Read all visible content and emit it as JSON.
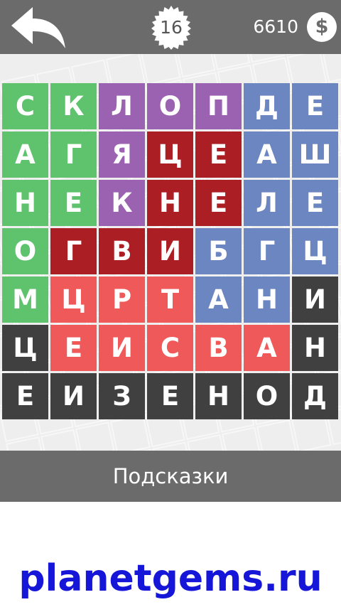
{
  "header": {
    "level": "16",
    "coins": "6610",
    "coin_symbol": "$"
  },
  "colors": {
    "green": "#5ec36c",
    "purple": "#9a62b0",
    "dark_red": "#ab1e24",
    "blue": "#6b86c0",
    "salmon": "#f0595a",
    "dark_gray": "#404040",
    "bar_gray": "#6b6b6b"
  },
  "board": {
    "rows": [
      [
        {
          "l": "С",
          "c": "green"
        },
        {
          "l": "К",
          "c": "green"
        },
        {
          "l": "Л",
          "c": "purple"
        },
        {
          "l": "О",
          "c": "purple"
        },
        {
          "l": "П",
          "c": "purple"
        },
        {
          "l": "Д",
          "c": "blue"
        },
        {
          "l": "Е",
          "c": "blue"
        }
      ],
      [
        {
          "l": "А",
          "c": "green"
        },
        {
          "l": "Г",
          "c": "green"
        },
        {
          "l": "Я",
          "c": "purple"
        },
        {
          "l": "Ц",
          "c": "dark_red"
        },
        {
          "l": "Е",
          "c": "dark_red"
        },
        {
          "l": "А",
          "c": "blue"
        },
        {
          "l": "Ш",
          "c": "blue"
        }
      ],
      [
        {
          "l": "Н",
          "c": "green"
        },
        {
          "l": "Е",
          "c": "green"
        },
        {
          "l": "К",
          "c": "purple"
        },
        {
          "l": "Н",
          "c": "dark_red"
        },
        {
          "l": "Е",
          "c": "dark_red"
        },
        {
          "l": "Л",
          "c": "blue"
        },
        {
          "l": "Е",
          "c": "blue"
        }
      ],
      [
        {
          "l": "О",
          "c": "green"
        },
        {
          "l": "Г",
          "c": "dark_red"
        },
        {
          "l": "В",
          "c": "dark_red"
        },
        {
          "l": "И",
          "c": "dark_red"
        },
        {
          "l": "Б",
          "c": "blue"
        },
        {
          "l": "Г",
          "c": "blue"
        },
        {
          "l": "Ц",
          "c": "blue"
        }
      ],
      [
        {
          "l": "М",
          "c": "green"
        },
        {
          "l": "Ц",
          "c": "salmon"
        },
        {
          "l": "Р",
          "c": "salmon"
        },
        {
          "l": "Т",
          "c": "salmon"
        },
        {
          "l": "А",
          "c": "blue"
        },
        {
          "l": "Н",
          "c": "blue"
        },
        {
          "l": "И",
          "c": "dark_gray"
        }
      ],
      [
        {
          "l": "Ц",
          "c": "dark_gray"
        },
        {
          "l": "Е",
          "c": "salmon"
        },
        {
          "l": "И",
          "c": "salmon"
        },
        {
          "l": "С",
          "c": "salmon"
        },
        {
          "l": "В",
          "c": "salmon"
        },
        {
          "l": "А",
          "c": "salmon"
        },
        {
          "l": "Н",
          "c": "dark_gray"
        }
      ],
      [
        {
          "l": "Е",
          "c": "dark_gray"
        },
        {
          "l": "И",
          "c": "dark_gray"
        },
        {
          "l": "З",
          "c": "dark_gray"
        },
        {
          "l": "Е",
          "c": "dark_gray"
        },
        {
          "l": "Н",
          "c": "dark_gray"
        },
        {
          "l": "О",
          "c": "dark_gray"
        },
        {
          "l": "Д",
          "c": "dark_gray"
        }
      ]
    ]
  },
  "hints_label": "Подсказки",
  "watermark": "planetgems.ru"
}
